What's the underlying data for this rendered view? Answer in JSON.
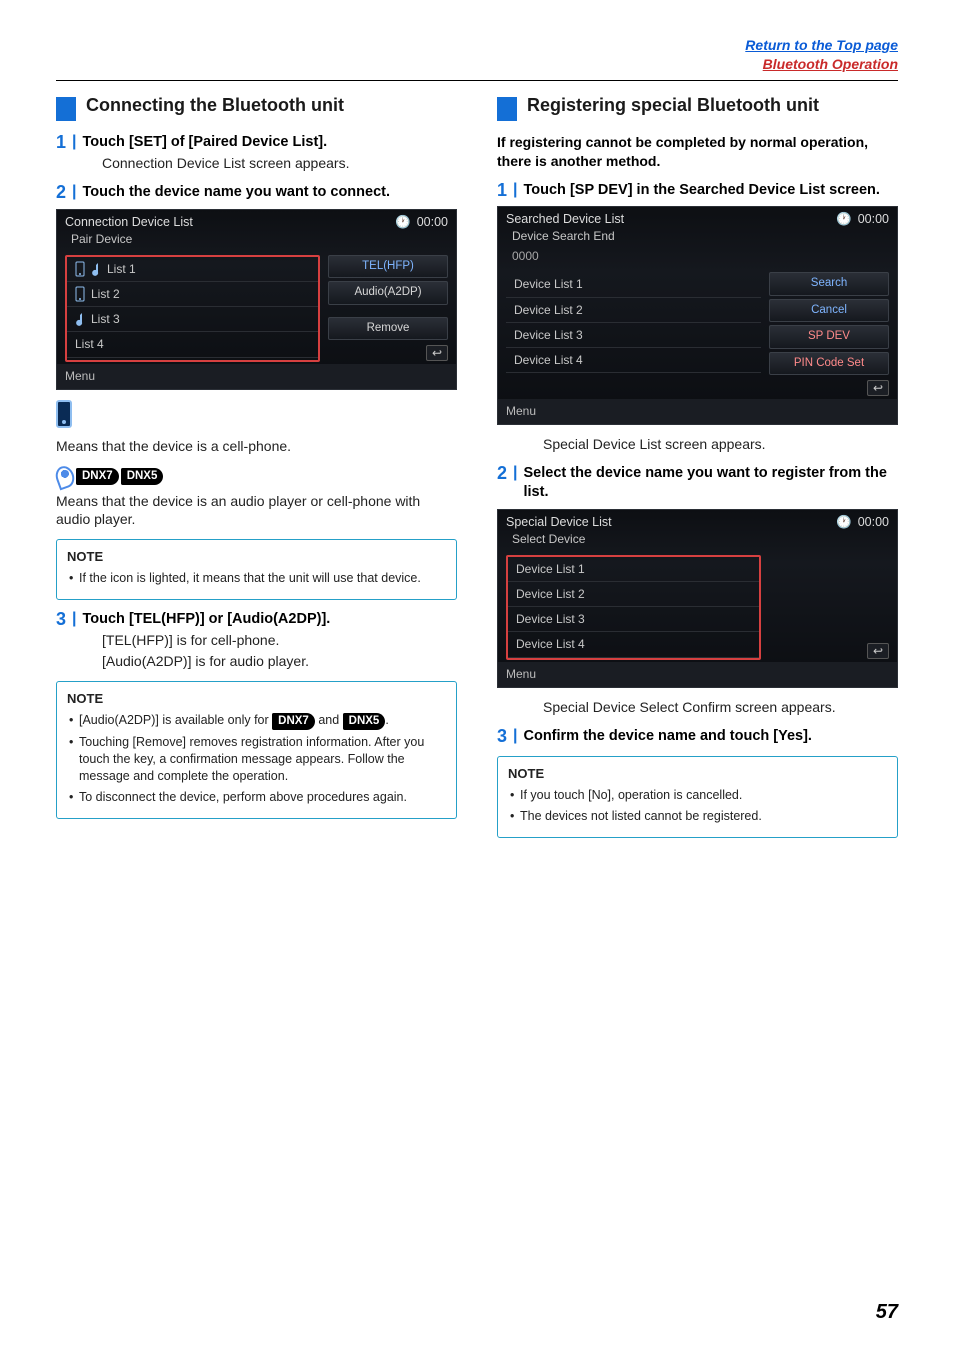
{
  "header": {
    "top_link": "Return to the Top page",
    "section_link": "Bluetooth Operation"
  },
  "page_number": "57",
  "left": {
    "title": "Connecting the Bluetooth unit",
    "step1": {
      "num": "1",
      "text": "Touch [SET] of [Paired Device List].",
      "sub": "Connection Device List screen appears."
    },
    "step2": {
      "num": "2",
      "text": "Touch the device name you want to connect."
    },
    "ss1": {
      "title": "Connection Device List",
      "clock": "00:00",
      "pair": "Pair Device",
      "items": [
        "List 1",
        "List 2",
        "List 3",
        "List 4"
      ],
      "side": [
        "TEL(HFP)",
        "Audio(A2DP)",
        "Remove"
      ],
      "menu": "Menu",
      "return": "↩"
    },
    "phone_desc": "Means that the device is a cell-phone.",
    "dnx_badges": [
      "DNX7",
      "DNX5"
    ],
    "audio_desc": "Means that the device is an audio player or cell-phone with audio player.",
    "note1": {
      "title": "NOTE",
      "items": [
        "If the icon is lighted, it means that the unit will use that device."
      ]
    },
    "step3": {
      "num": "3",
      "text": "Touch [TEL(HFP)] or [Audio(A2DP)].",
      "sub1": "[TEL(HFP)] is for cell-phone.",
      "sub2": "[Audio(A2DP)] is for audio player."
    },
    "note2": {
      "title": "NOTE",
      "item1_pre": "[Audio(A2DP)] is available only for ",
      "item1_mid": " and ",
      "item1_post": ".",
      "item2": "Touching [Remove] removes registration information. After you touch the key, a confirmation message appears. Follow the message and complete the operation.",
      "item3": "To disconnect the device, perform above procedures again."
    }
  },
  "right": {
    "title": "Registering special Bluetooth unit",
    "lead": "If registering cannot be completed by normal operation, there is another method.",
    "step1": {
      "num": "1",
      "text": "Touch [SP DEV] in the Searched Device List screen."
    },
    "ss1": {
      "title": "Searched Device List",
      "clock": "00:00",
      "status": "Device Search End",
      "count": "0000",
      "items": [
        "Device List 1",
        "Device List 2",
        "Device List 3",
        "Device List 4"
      ],
      "side": [
        "Search",
        "Cancel",
        "SP DEV",
        "PIN Code Set"
      ],
      "menu": "Menu",
      "return": "↩"
    },
    "step1_sub": "Special Device List screen appears.",
    "step2": {
      "num": "2",
      "text": "Select the device name you want to register from the list."
    },
    "ss2": {
      "title": "Special Device List",
      "clock": "00:00",
      "status": "Select Device",
      "items": [
        "Device List 1",
        "Device List 2",
        "Device List 3",
        "Device List 4"
      ],
      "menu": "Menu",
      "return": "↩"
    },
    "step2_sub": "Special Device Select Confirm screen appears.",
    "step3": {
      "num": "3",
      "text": "Confirm the device name and touch [Yes]."
    },
    "note": {
      "title": "NOTE",
      "items": [
        "If you touch [No], operation is cancelled.",
        "The devices not listed cannot be registered."
      ]
    }
  }
}
